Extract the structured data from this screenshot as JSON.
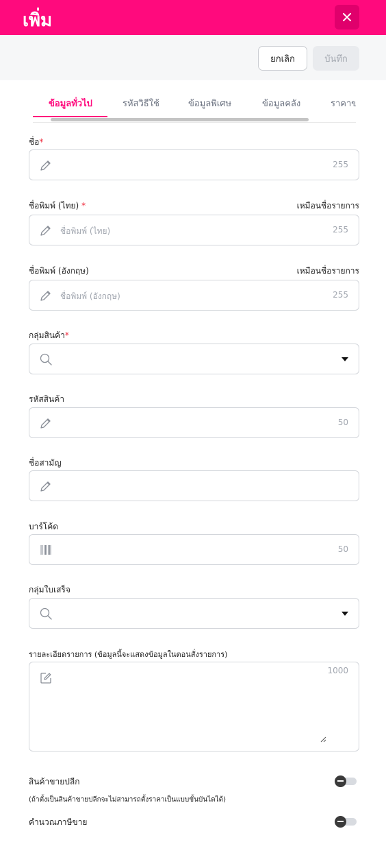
{
  "header": {
    "title": "เพิ่ม",
    "close_icon": "close-icon"
  },
  "actions": {
    "cancel_label": "ยกเลิก",
    "save_label": "บันทึก"
  },
  "tabs": [
    {
      "label": "ข้อมูลทั่วไป",
      "active": true
    },
    {
      "label": "รหัสวิธีใช้",
      "active": false
    },
    {
      "label": "ข้อมูลพิเศษ",
      "active": false
    },
    {
      "label": "ข้อมูลคลัง",
      "active": false
    },
    {
      "label": "ราคาข",
      "active": false
    }
  ],
  "fields": {
    "name": {
      "label": "ชื่อ",
      "required": "*",
      "counter": "255"
    },
    "print_name_th": {
      "label": "ชื่อพิมพ์ (ไทย)",
      "required": "*",
      "right_label": "เหมือนชื่อรายการ",
      "placeholder": "ชื่อพิมพ์ (ไทย)",
      "counter": "255"
    },
    "print_name_en": {
      "label": "ชื่อพิมพ์ (อังกฤษ)",
      "right_label": "เหมือนชื่อรายการ",
      "placeholder": "ชื่อพิมพ์ (อังกฤษ)",
      "counter": "255"
    },
    "product_group": {
      "label": "กลุ่มสินค้า",
      "required": "*"
    },
    "product_code": {
      "label": "รหัสสินค้า",
      "counter": "50"
    },
    "common_name": {
      "label": "ชื่อสามัญ"
    },
    "barcode": {
      "label": "บาร์โค้ด",
      "counter": "50"
    },
    "receipt_group": {
      "label": "กลุ่มใบเสร็จ"
    },
    "details": {
      "label": "รายละเอียดรายการ (ข้อมูลนี้จะแสดงข้อมูลในตอนสั่งรายการ)",
      "counter": "1000"
    }
  },
  "toggles": {
    "retail": {
      "label": "สินค้าขายปลีก",
      "note": "(ถ้าตั้งเป็นสินค้าขายปลีกจะไม่สามารถตั้งราคาเป็นแบบขั้นบันไดได้)",
      "on": false
    },
    "sales_tax": {
      "label": "คำนวณภาษีขาย",
      "on": false
    }
  }
}
